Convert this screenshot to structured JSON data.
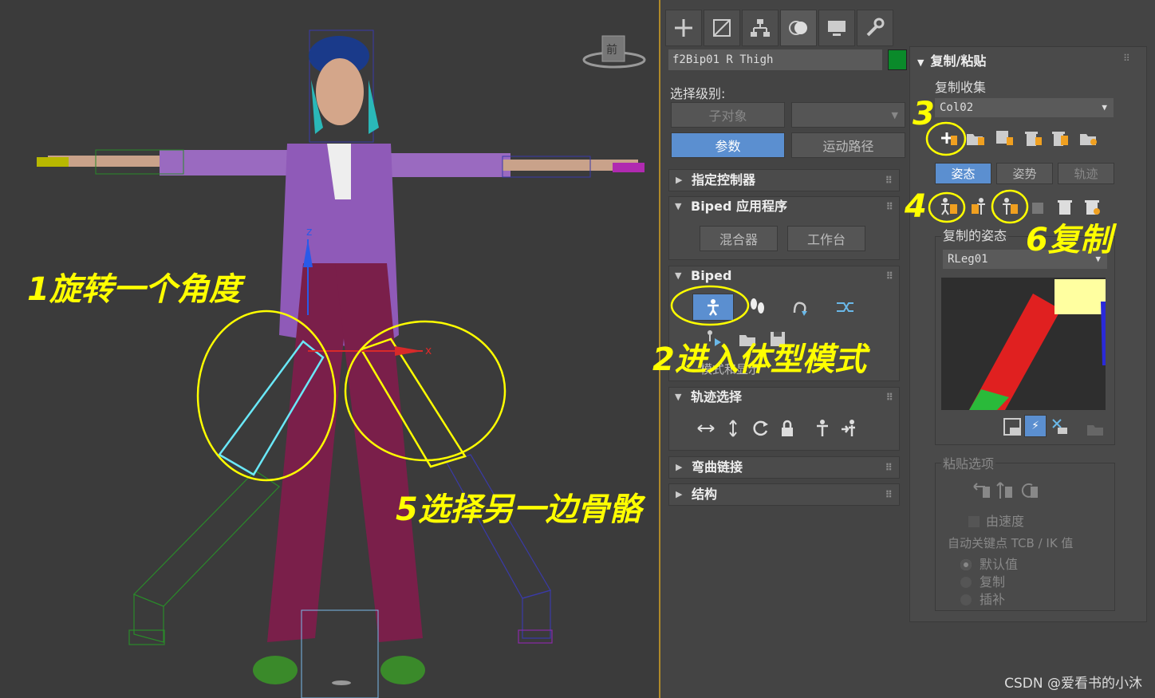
{
  "object_name": "f2Bip01 R Thigh",
  "colors": {
    "object_color": "#0a8a2a",
    "annotation": "#ffff00",
    "active_button": "#5b8fd0"
  },
  "command_tabs": [
    "create-icon",
    "modify-icon",
    "hierarchy-icon",
    "motion-icon",
    "display-icon",
    "utilities-icon"
  ],
  "selection_level": {
    "label": "选择级别:",
    "sub_object": "子对象",
    "params": "参数",
    "trajectory": "运动路径"
  },
  "rollouts": {
    "assign_controller": "指定控制器",
    "biped_apps": "Biped 应用程序",
    "mixer": "混合器",
    "workbench": "工作台",
    "biped": "Biped",
    "mode_display": "模式和显示",
    "track_selection": "轨迹选择",
    "bend_links": "弯曲链接",
    "structure": "结构"
  },
  "copy_paste": {
    "title": "复制/粘贴",
    "collection_label": "复制收集",
    "collection_value": "Col02",
    "tabs": [
      "姿态",
      "姿势",
      "轨迹"
    ],
    "copied_pose_label": "复制的姿态",
    "copied_pose_value": "RLeg01",
    "paste_options_label": "粘贴选项",
    "by_velocity": "由速度",
    "auto_key_label": "自动关键点 TCB / IK 值",
    "radio_default": "默认值",
    "radio_copy": "复制",
    "radio_interp": "插补"
  },
  "viewcube_label": "前",
  "annotations": {
    "step1": "1旋转一个角度",
    "step2": "2进入体型模式",
    "step3": "3",
    "step4": "4",
    "step5": "5选择另一边骨骼",
    "step6": "6复制"
  },
  "gizmo": {
    "x": "x",
    "z": "z"
  },
  "watermark": "CSDN @爱看书的小沐"
}
